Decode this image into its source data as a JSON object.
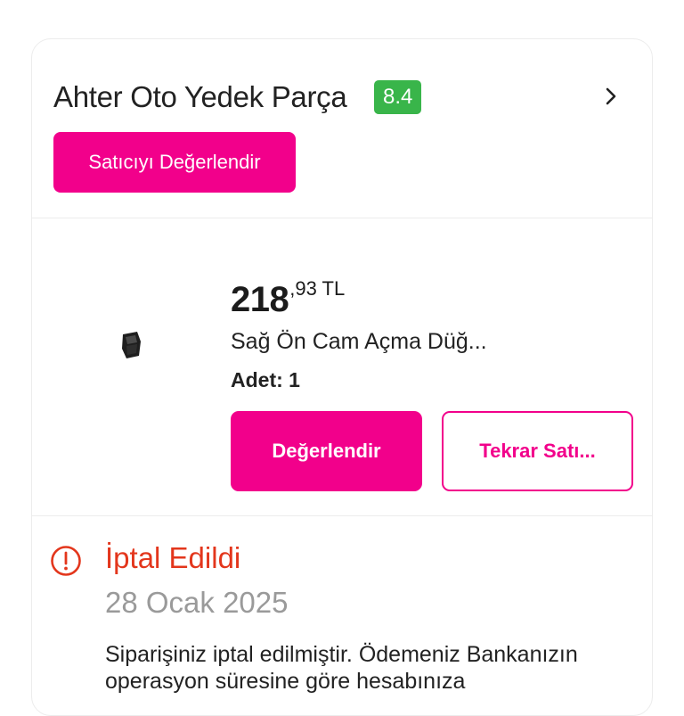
{
  "seller": {
    "name": "Ahter Oto Yedek Parça",
    "score": "8.4",
    "rate_button": "Satıcıyı Değerlendir"
  },
  "product": {
    "price_integer": "218",
    "price_decimal": ",93 TL",
    "name": "Sağ Ön Cam Açma Düğ...",
    "quantity": "Adet: 1",
    "review_button": "Değerlendir",
    "rebuy_button": "Tekrar Satı..."
  },
  "status": {
    "title": "İptal Edildi",
    "date": "28 Ocak 2025",
    "message": "Siparişiniz iptal edilmiştir. Ödemeniz Bankanızın operasyon süresine göre hesabınıza"
  },
  "colors": {
    "brand": "#f2008b",
    "score_badge": "#39b54a",
    "cancelled": "#e3361c",
    "muted": "#9a9a9a"
  },
  "icons": {
    "chevron": "chevron-right-icon",
    "alert": "alert-circle-icon",
    "product": "window-switch-product-image"
  }
}
